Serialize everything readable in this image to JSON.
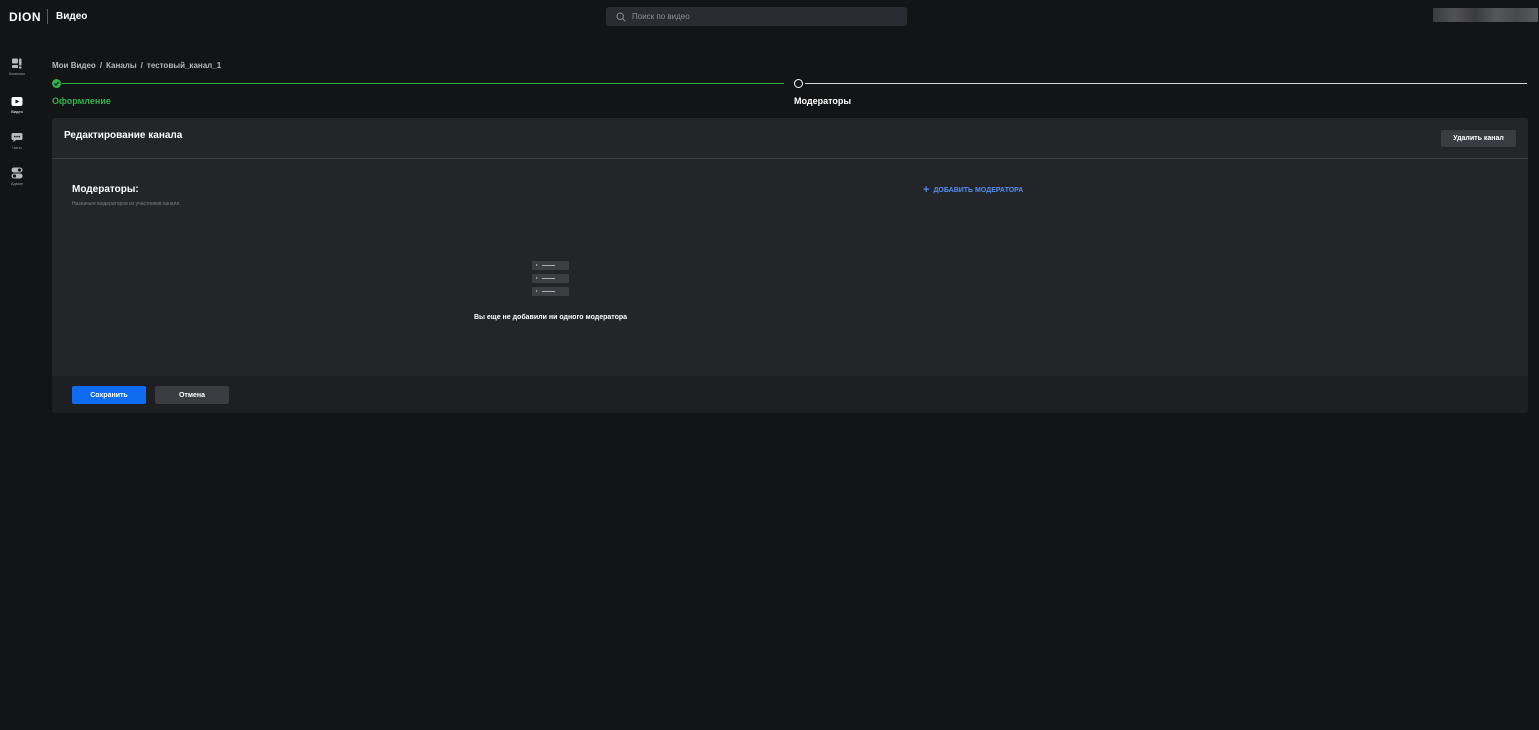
{
  "header": {
    "logo": "DION",
    "app_name": "Видео",
    "search_placeholder": "Поиск по видео"
  },
  "sidebar": {
    "items": [
      {
        "label": "Комнаты",
        "icon": "rooms-icon",
        "active": false
      },
      {
        "label": "Видео",
        "icon": "video-icon",
        "active": true
      },
      {
        "label": "Чаты",
        "icon": "chat-icon",
        "active": false
      },
      {
        "label": "Админ",
        "icon": "admin-icon",
        "active": false
      }
    ]
  },
  "breadcrumb": {
    "items": [
      "Мои Видео",
      "Каналы",
      "тестовый_канал_1"
    ],
    "separator": "/"
  },
  "stepper": {
    "steps": [
      {
        "label": "Оформление",
        "state": "done"
      },
      {
        "label": "Модераторы",
        "state": "current"
      }
    ]
  },
  "card": {
    "title": "Редактирование канала",
    "delete_label": "Удалить канал",
    "moderators_title": "Модераторы:",
    "moderators_subtitle": "Назначьте модераторов из участников канала",
    "add_moderator_label": "ДОБАВИТЬ МОДЕРАТОРА",
    "empty_text": "Вы еще не добавили ни одного модератора",
    "save_label": "Сохранить",
    "cancel_label": "Отмена"
  },
  "colors": {
    "accent": "#0f6cf2",
    "success": "#2fb34a",
    "link": "#4f8ef0",
    "background": "#131416",
    "card": "#242529"
  }
}
